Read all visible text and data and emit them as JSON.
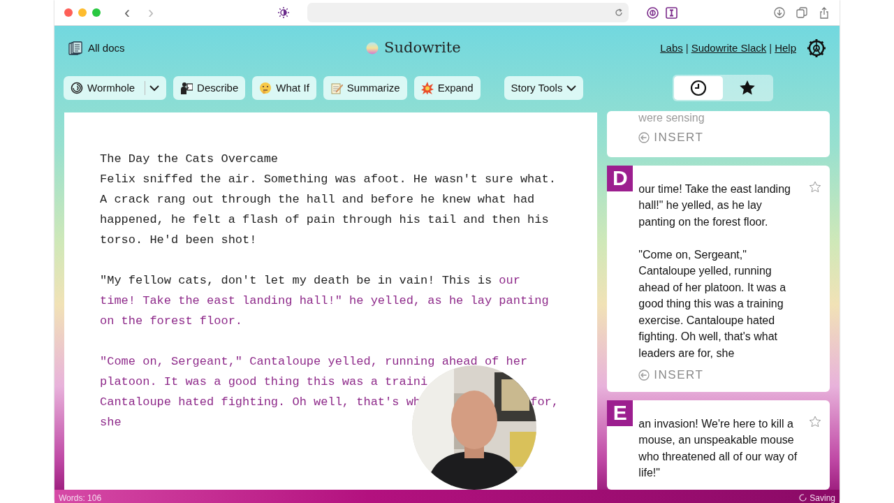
{
  "browser": {
    "back": "‹",
    "forward": "›"
  },
  "header": {
    "all_docs": "All docs",
    "brand": "Sudowrite",
    "links": [
      {
        "label": "Labs"
      },
      {
        "label": "Sudowrite Slack"
      },
      {
        "label": "Help"
      }
    ],
    "separator": "|"
  },
  "toolbar": {
    "tools": [
      {
        "label": "Wormhole",
        "kind": "dropdown"
      },
      {
        "label": "Describe",
        "kind": "plain"
      },
      {
        "label": "What If",
        "kind": "plain"
      },
      {
        "label": "Summarize",
        "kind": "plain"
      },
      {
        "label": "Expand",
        "kind": "plain"
      }
    ],
    "story_tools": "Story Tools",
    "views": [
      {
        "selected": true
      },
      {
        "selected": false
      }
    ]
  },
  "editor": {
    "paragraphs": [
      {
        "lines": [
          {
            "spans": [
              {
                "text": "The Day the Cats Overcame",
                "suggested": false
              }
            ]
          },
          {
            "spans": [
              {
                "text": "Felix sniffed the air. Something was afoot. He wasn't sure what.",
                "suggested": false
              }
            ]
          },
          {
            "spans": [
              {
                "text": "A crack rang out through the hall and before he knew what had",
                "suggested": false
              }
            ]
          },
          {
            "spans": [
              {
                "text": "happened, he felt a flash of pain through his tail and then his",
                "suggested": false
              }
            ]
          },
          {
            "spans": [
              {
                "text": "torso. He'd been shot!",
                "suggested": false
              }
            ]
          }
        ]
      },
      {
        "lines": [
          {
            "spans": [
              {
                "text": "\"My fellow cats, don't let my death be in vain! This is ",
                "suggested": false
              },
              {
                "text": "our",
                "suggested": true
              }
            ]
          },
          {
            "spans": [
              {
                "text": "time! Take the east landing hall!\" he yelled, as he lay panting",
                "suggested": true
              }
            ]
          },
          {
            "spans": [
              {
                "text": "on the forest floor.",
                "suggested": true
              }
            ]
          }
        ]
      },
      {
        "lines": [
          {
            "spans": [
              {
                "text": "\"Come on, Sergeant,\" Cantaloupe yelled, running ahead of her",
                "suggested": true
              }
            ]
          },
          {
            "spans": [
              {
                "text": "platoon. It was a good thing this was a traini",
                "suggested": true
              }
            ]
          },
          {
            "spans": [
              {
                "text": "Cantaloupe hated fighting. Oh well, that's wh",
                "suggested": true
              },
              {
                "text": "for,",
                "suggested": true
              }
            ],
            "occluded": true
          },
          {
            "spans": [
              {
                "text": "she",
                "suggested": true
              }
            ]
          }
        ]
      }
    ]
  },
  "sidebar": {
    "cards": [
      {
        "faded": "were sensing",
        "insert": "INSERT"
      },
      {
        "letter": "D",
        "paragraphs": [
          "our time! Take the east landing hall!\" he yelled, as he lay panting on the forest floor.",
          "\"Come on, Sergeant,\" Cantaloupe yelled, running ahead of her platoon. It was a good thing this was a training exercise. Cantaloupe hated fighting. Oh well, that's what leaders are for, she"
        ],
        "insert": "INSERT",
        "starred": false
      },
      {
        "letter": "E",
        "paragraphs": [
          "an invasion! We're here to kill a mouse, an unspeakable mouse who threatened all of our way of life!\""
        ],
        "starred": false
      }
    ]
  },
  "status": {
    "words": "Words: 106",
    "saving": "Saving"
  }
}
